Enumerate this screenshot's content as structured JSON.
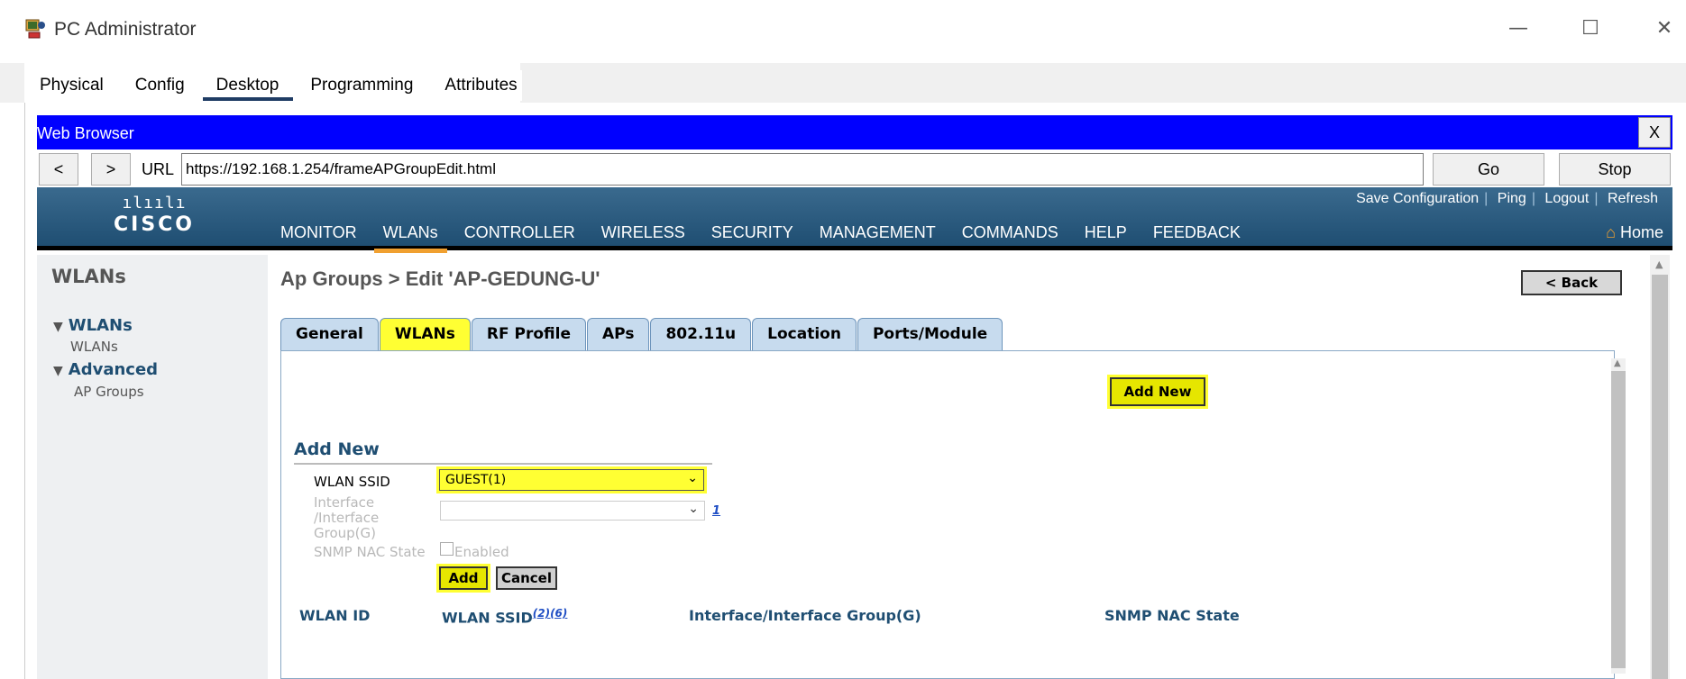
{
  "window": {
    "title": "PC Administrator",
    "minimize": "—",
    "maximize": "☐",
    "close": "✕"
  },
  "device_tabs": [
    "Physical",
    "Config",
    "Desktop",
    "Programming",
    "Attributes"
  ],
  "active_device_tab": "Desktop",
  "browser": {
    "title": "Web Browser",
    "close": "X",
    "back": "<",
    "forward": ">",
    "url_label": "URL",
    "url": "https://192.168.1.254/frameAPGroupEdit.html",
    "go": "Go",
    "stop": "Stop"
  },
  "cisco": {
    "logo_bars": "ılıılı",
    "logo_word": "CISCO",
    "top_links": [
      "Save Configuration",
      "Ping",
      "Logout",
      "Refresh"
    ],
    "menu": [
      "MONITOR",
      "WLANs",
      "CONTROLLER",
      "WIRELESS",
      "SECURITY",
      "MANAGEMENT",
      "COMMANDS",
      "HELP",
      "FEEDBACK"
    ],
    "active_menu": "WLANs",
    "home": "Home",
    "accent_color": "#f0a030"
  },
  "sidebar": {
    "title": "WLANs",
    "groups": [
      {
        "label": "WLANs",
        "items": [
          "WLANs"
        ]
      },
      {
        "label": "Advanced",
        "items": [
          "AP Groups"
        ]
      }
    ]
  },
  "main": {
    "title": "Ap Groups > Edit  'AP-GEDUNG-U'",
    "back_button": "< Back",
    "tabs": [
      "General",
      "WLANs",
      "RF Profile",
      "APs",
      "802.11u",
      "Location",
      "Ports/Module"
    ],
    "active_tab": "WLANs",
    "add_new_button": "Add New",
    "section_title": "Add New",
    "form": {
      "ssid_label": "WLAN SSID",
      "ssid_value": "GUEST(1)",
      "iface_label": "Interface /Interface Group(G)",
      "iface_value": "",
      "iface_footnote": "1",
      "snmp_label": "SNMP NAC State",
      "snmp_checkbox_label": "Enabled",
      "add_button": "Add",
      "cancel_button": "Cancel"
    },
    "table_headers": {
      "wlan_id": "WLAN ID",
      "wlan_ssid": "WLAN SSID",
      "wlan_ssid_refs": "(2)(6)",
      "interface": "Interface/Interface Group(G)",
      "snmp": "SNMP NAC State"
    }
  },
  "highlight_color": "#ffff33"
}
